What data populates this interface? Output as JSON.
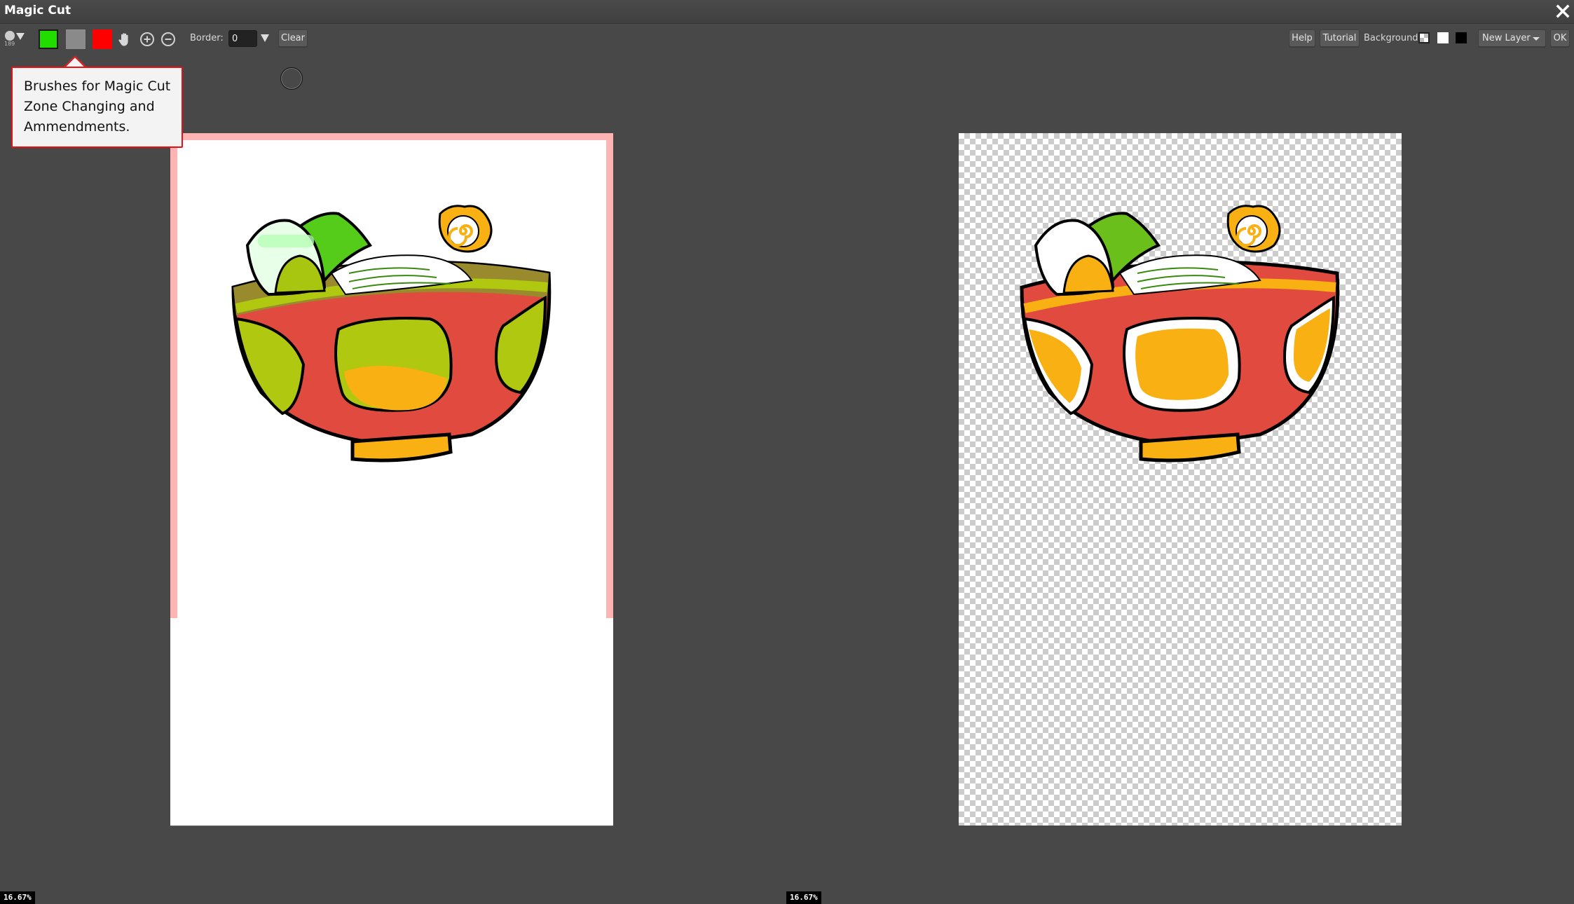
{
  "window": {
    "title": "Magic Cut",
    "close_icon": "close-icon"
  },
  "toolbar": {
    "brush": {
      "size": "189",
      "icon": "brush-circle-icon"
    },
    "swatches": [
      {
        "name": "keep-brush",
        "color": "#22dd00"
      },
      {
        "name": "eraser-brush",
        "color": "#8a8a8a"
      },
      {
        "name": "remove-brush",
        "color": "#ff0000"
      }
    ],
    "tools": [
      "hand-icon",
      "zoom-in-icon",
      "zoom-out-icon"
    ],
    "border_label": "Border:",
    "border_value": "0",
    "clear_label": "Clear",
    "help_label": "Help",
    "tutorial_label": "Tutorial",
    "background_label": "Background:",
    "background_options": [
      "transparent",
      "white",
      "black"
    ],
    "layer_select": "New Layer",
    "ok_label": "OK"
  },
  "tooltip": {
    "text": "Brushes for Magic Cut Zone Changing and Ammendments."
  },
  "left_canvas": {
    "zoom": "16.67%",
    "overlay_color": "#ffb4b4"
  },
  "right_canvas": {
    "zoom": "16.67%"
  },
  "art_colors": {
    "bowl_red": "#e04a3f",
    "bowl_orange": "#f8b013",
    "egg_white": "#ffffff",
    "nori_green": "#6bbf1a",
    "outline": "#000000"
  }
}
